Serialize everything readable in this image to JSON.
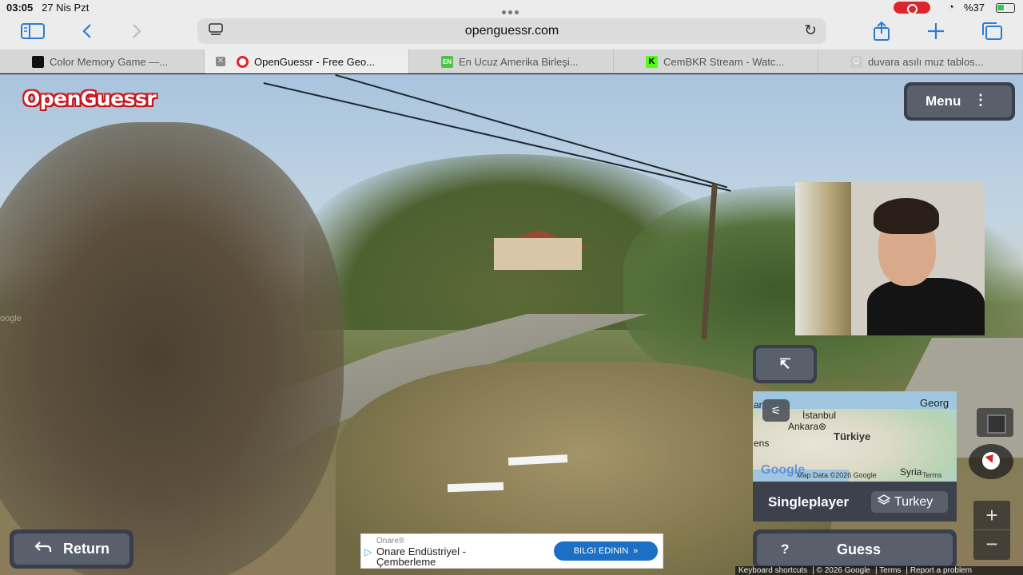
{
  "status_bar": {
    "time": "03:05",
    "date": "27 Nis Pzt",
    "battery": "%37"
  },
  "browser": {
    "url": "openguessr.com",
    "tabs": [
      {
        "label": "Color Memory Game —...",
        "favicon_color": "#111111",
        "active": false
      },
      {
        "label": "OpenGuessr - Free Geo...",
        "favicon_color": "#e0242b",
        "active": true
      },
      {
        "label": "En Ucuz Amerika Birleşi...",
        "favicon_color": "#4cc24a",
        "active": false
      },
      {
        "label": "CemBKR Stream - Watc...",
        "favicon_color": "#53fc18",
        "active": false
      },
      {
        "label": "duvara asılı muz tablos...",
        "favicon_color": "#bbbbbb",
        "active": false
      }
    ]
  },
  "game": {
    "logo": "OpenGuessr",
    "menu_label": "Menu",
    "mode_label": "Singleplayer",
    "country_label": "Turkey",
    "guess_label": "Guess",
    "help_label": "?",
    "return_label": "Return",
    "expand_icon": "↸"
  },
  "minimap": {
    "labels": {
      "istanbul": "İstanbul",
      "ankara": "Ankara⊛",
      "turkiye": "Türkiye",
      "georgia": "Georg",
      "syria": "Syria",
      "ens": "ens",
      "ar": "ar"
    },
    "google": "Google",
    "attribution": "Map Data ©2026 Google",
    "terms": "Terms"
  },
  "ad": {
    "brand": "Onare®",
    "title": "Onare Endüstriyel - Çemberleme",
    "cta": "BILGI EDININ"
  },
  "footer": {
    "keyboard": "Keyboard shortcuts",
    "copyright": "© 2026 Google",
    "terms": "Terms",
    "report": "Report a problem"
  },
  "watermark": "oogle",
  "colors": {
    "accent": "#2b7bd6",
    "logo_red": "#d51a22",
    "panel": "#3a3e4a",
    "button": "#5a5f6c",
    "ad_cta": "#1b6fc4"
  }
}
